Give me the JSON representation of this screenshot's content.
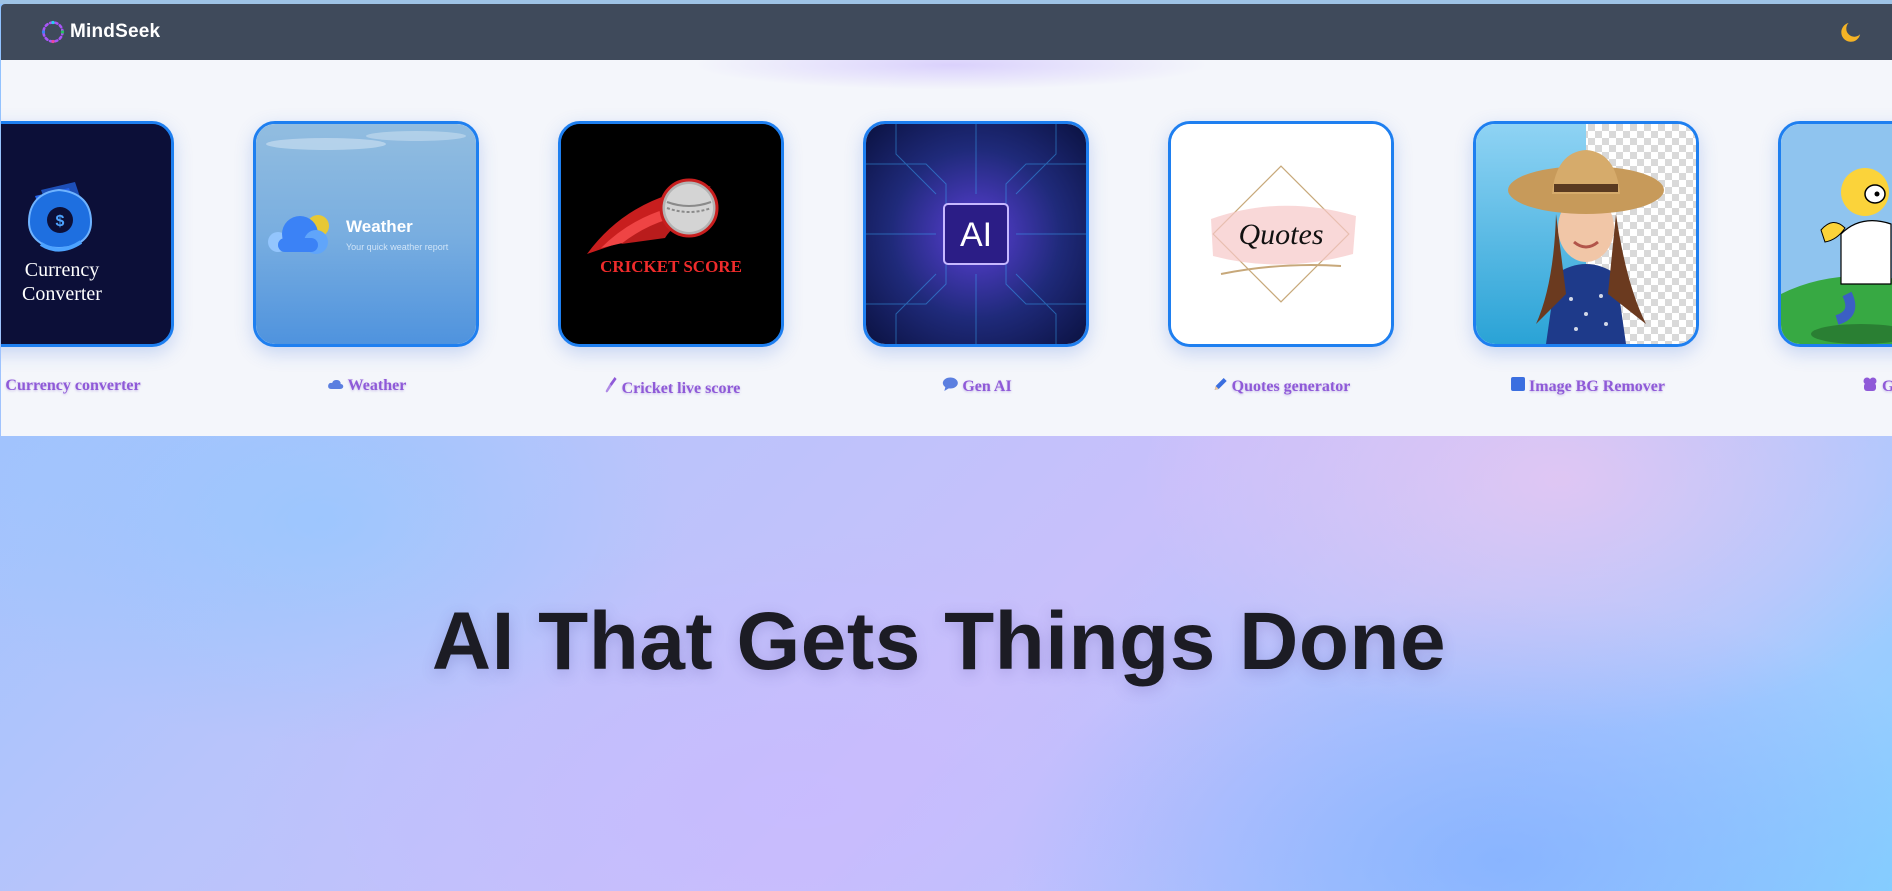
{
  "brand": {
    "name": "MindSeek",
    "logo_icon": "spinner-ring-icon"
  },
  "header": {
    "theme_toggle_icon": "crescent-moon-icon"
  },
  "tools": [
    {
      "label": "Currency converter",
      "image_text": [
        "Currency",
        "Converter"
      ],
      "icon": ""
    },
    {
      "label": "Weather",
      "image_text": [
        "Weather",
        "Your quick weather report"
      ],
      "icon": "cloud-icon"
    },
    {
      "label": "Cricket live score",
      "image_text": [
        "CRICKET SCORE"
      ],
      "icon": "cricket-bat-icon"
    },
    {
      "label": "Gen AI",
      "image_text": [
        "AI"
      ],
      "icon": "speech-bubble-icon"
    },
    {
      "label": "Quotes generator",
      "image_text": [
        "Quotes"
      ],
      "icon": "pencil-icon"
    },
    {
      "label": "Image BG Remover",
      "image_text": [],
      "icon": "image-square-icon"
    },
    {
      "label": "GIF g",
      "image_text": [],
      "icon": "character-icon"
    }
  ],
  "hero": {
    "title": "AI That Gets Things Done"
  },
  "colors": {
    "navbar": "#3f4a5b",
    "card_border": "#1e7ff0",
    "label": "#8f5ad8",
    "hero_text": "#1c1c24"
  }
}
